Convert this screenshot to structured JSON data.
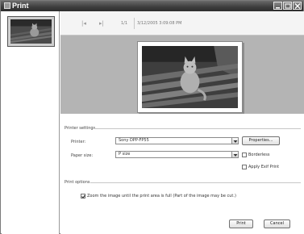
{
  "window": {
    "title": "Print"
  },
  "toolbar": {
    "prev_icon": "first-page-icon",
    "next_icon": "last-page-icon",
    "page_counter": "1/1",
    "timestamp": "3/12/2005 3:09:08 PM"
  },
  "printer_settings": {
    "group_label": "Printer settings",
    "printer_label": "Printer:",
    "printer_value": "Sony DPP-FP55",
    "properties_button": "Properties...",
    "paper_size_label": "Paper size:",
    "paper_size_value": "P size",
    "borderless_label": "Borderless",
    "borderless_checked": false,
    "exif_label": "Apply Exif Print",
    "exif_checked": false
  },
  "print_options": {
    "group_label": "Print options",
    "zoom_label": "Zoom the image until the print area is full (Part of the image may be cut.)",
    "zoom_checked": true
  },
  "buttons": {
    "print": "Print",
    "cancel": "Cancel"
  },
  "colors": {
    "titlebar": "#3c3c3c",
    "preview_bg": "#b4b4b4",
    "window_bg": "#ffffff"
  }
}
